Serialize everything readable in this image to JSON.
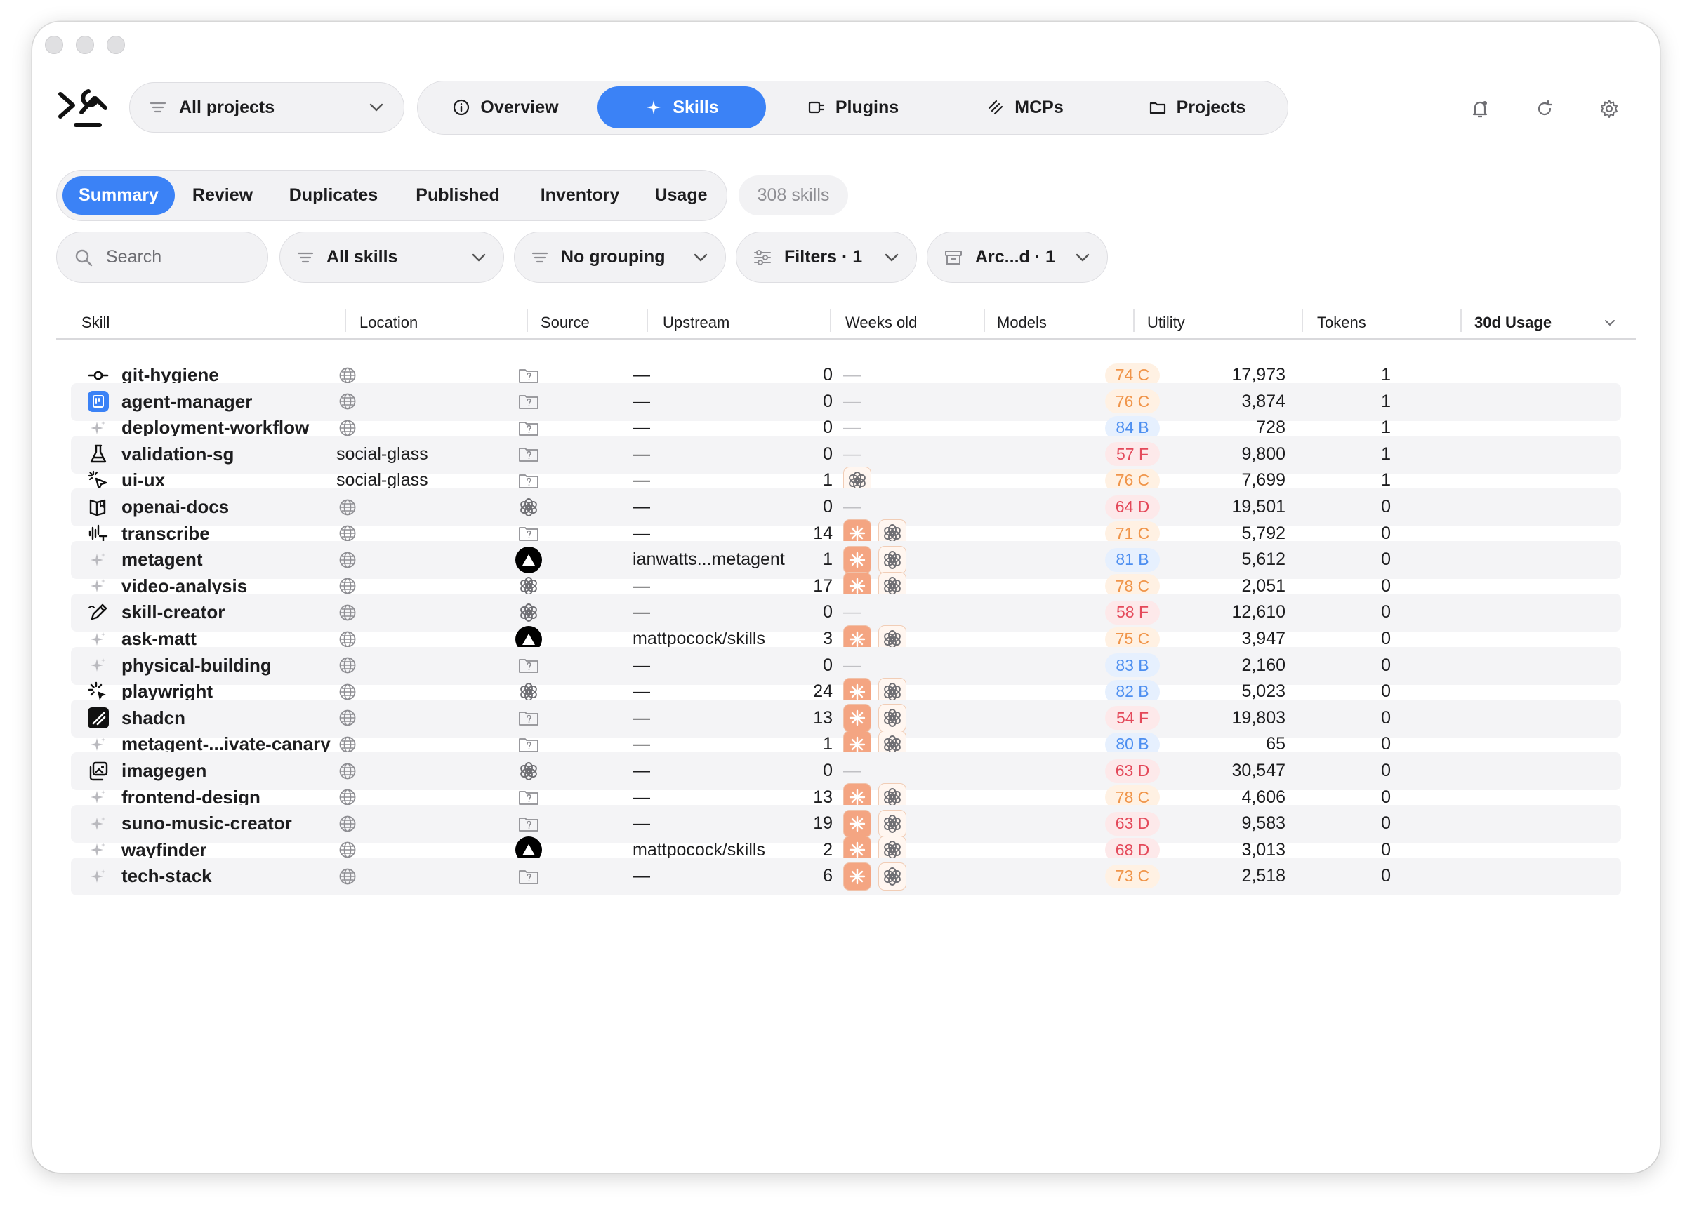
{
  "header": {
    "project_selector": "All projects",
    "nav_tabs": [
      {
        "label": "Overview",
        "icon": "info-circle-icon"
      },
      {
        "label": "Skills",
        "icon": "sparkle-icon",
        "active": true
      },
      {
        "label": "Plugins",
        "icon": "plug-icon"
      },
      {
        "label": "MCPs",
        "icon": "mcp-icon"
      },
      {
        "label": "Projects",
        "icon": "folder-icon"
      }
    ],
    "actions": [
      "bell-icon",
      "refresh-icon",
      "gear-icon"
    ]
  },
  "subnav": {
    "tabs": [
      "Summary",
      "Review",
      "Duplicates",
      "Published",
      "Inventory",
      "Usage"
    ],
    "active": "Summary",
    "count": "308 skills"
  },
  "filters": {
    "search_placeholder": "Search",
    "scope": "All skills",
    "grouping": "No grouping",
    "filters": "Filters · 1",
    "archive": "Arc...d · 1"
  },
  "table": {
    "columns": [
      "Skill",
      "Location",
      "Source",
      "Upstream",
      "Weeks old",
      "Models",
      "Utility",
      "Tokens",
      "30d Usage"
    ],
    "sorted_column": "30d Usage",
    "sort_direction": "descending",
    "colors": {
      "grade_C": "#f0954a",
      "grade_B": "#4c8ef0",
      "grade_D": "#e4495a",
      "grade_F": "#e4495a",
      "accent": "#3b82f6"
    },
    "rows": [
      {
        "skill": "git-hygiene",
        "icon": "commit-icon",
        "location": "",
        "source": "unknown",
        "upstream": "—",
        "weeks": "0",
        "models": [],
        "utility": "74 C",
        "grade": "C",
        "tokens": "17,973",
        "usage": "1"
      },
      {
        "skill": "agent-manager",
        "icon": "app-icon",
        "location": "",
        "source": "unknown",
        "upstream": "—",
        "weeks": "0",
        "models": [],
        "utility": "76 C",
        "grade": "C",
        "tokens": "3,874",
        "usage": "1"
      },
      {
        "skill": "deployment-workflow",
        "icon": "sparkle-icon",
        "location": "",
        "source": "unknown",
        "upstream": "—",
        "weeks": "0",
        "models": [],
        "utility": "84 B",
        "grade": "B",
        "tokens": "728",
        "usage": "1"
      },
      {
        "skill": "validation-sg",
        "icon": "flask-icon",
        "location": "social-glass",
        "source": "unknown",
        "upstream": "—",
        "weeks": "0",
        "models": [],
        "utility": "57 F",
        "grade": "F",
        "tokens": "9,800",
        "usage": "1"
      },
      {
        "skill": "ui-ux",
        "icon": "cursor-click-icon",
        "location": "social-glass",
        "source": "unknown",
        "upstream": "—",
        "weeks": "1",
        "models": [
          "openai"
        ],
        "utility": "76 C",
        "grade": "C",
        "tokens": "7,699",
        "usage": "1"
      },
      {
        "skill": "openai-docs",
        "icon": "book-icon",
        "location": "",
        "source": "openai",
        "upstream": "—",
        "weeks": "0",
        "models": [],
        "utility": "64 D",
        "grade": "D",
        "tokens": "19,501",
        "usage": "0"
      },
      {
        "skill": "transcribe",
        "icon": "waveform-icon",
        "location": "",
        "source": "unknown",
        "upstream": "—",
        "weeks": "14",
        "models": [
          "claude",
          "openai"
        ],
        "utility": "71 C",
        "grade": "C",
        "tokens": "5,792",
        "usage": "0"
      },
      {
        "skill": "metagent",
        "icon": "sparkle-icon",
        "location": "",
        "source": "vercel",
        "upstream": "ianwatts...metagent",
        "weeks": "1",
        "models": [
          "claude",
          "openai"
        ],
        "utility": "81 B",
        "grade": "B",
        "tokens": "5,612",
        "usage": "0"
      },
      {
        "skill": "video-analysis",
        "icon": "sparkle-icon",
        "location": "",
        "source": "openai",
        "upstream": "—",
        "weeks": "17",
        "models": [
          "claude",
          "openai"
        ],
        "utility": "78 C",
        "grade": "C",
        "tokens": "2,051",
        "usage": "0"
      },
      {
        "skill": "skill-creator",
        "icon": "pen-icon",
        "location": "",
        "source": "openai",
        "upstream": "—",
        "weeks": "0",
        "models": [],
        "utility": "58 F",
        "grade": "F",
        "tokens": "12,610",
        "usage": "0"
      },
      {
        "skill": "ask-matt",
        "icon": "sparkle-icon",
        "location": "",
        "source": "vercel",
        "upstream": "mattpocock/skills",
        "weeks": "3",
        "models": [
          "claude",
          "openai"
        ],
        "utility": "75 C",
        "grade": "C",
        "tokens": "3,947",
        "usage": "0"
      },
      {
        "skill": "physical-building",
        "icon": "sparkle-icon",
        "location": "",
        "source": "unknown",
        "upstream": "—",
        "weeks": "0",
        "models": [],
        "utility": "83 B",
        "grade": "B",
        "tokens": "2,160",
        "usage": "0"
      },
      {
        "skill": "playwright",
        "icon": "burst-cursor-icon",
        "location": "",
        "source": "openai",
        "upstream": "—",
        "weeks": "24",
        "models": [
          "claude",
          "openai"
        ],
        "utility": "82 B",
        "grade": "B",
        "tokens": "5,023",
        "usage": "0"
      },
      {
        "skill": "shadcn",
        "icon": "shadcn-icon",
        "location": "",
        "source": "unknown",
        "upstream": "—",
        "weeks": "13",
        "models": [
          "claude",
          "openai"
        ],
        "utility": "54 F",
        "grade": "F",
        "tokens": "19,803",
        "usage": "0"
      },
      {
        "skill": "metagent-...ivate-canary",
        "icon": "sparkle-icon",
        "location": "",
        "source": "unknown",
        "upstream": "—",
        "weeks": "1",
        "models": [
          "claude",
          "openai"
        ],
        "utility": "80 B",
        "grade": "B",
        "tokens": "65",
        "usage": "0"
      },
      {
        "skill": "imagegen",
        "icon": "image-icon",
        "location": "",
        "source": "openai",
        "upstream": "—",
        "weeks": "0",
        "models": [],
        "utility": "63 D",
        "grade": "D",
        "tokens": "30,547",
        "usage": "0"
      },
      {
        "skill": "frontend-design",
        "icon": "sparkle-icon",
        "location": "",
        "source": "unknown",
        "upstream": "—",
        "weeks": "13",
        "models": [
          "claude",
          "openai"
        ],
        "utility": "78 C",
        "grade": "C",
        "tokens": "4,606",
        "usage": "0"
      },
      {
        "skill": "suno-music-creator",
        "icon": "sparkle-icon",
        "location": "",
        "source": "unknown",
        "upstream": "—",
        "weeks": "19",
        "models": [
          "claude",
          "openai"
        ],
        "utility": "63 D",
        "grade": "D",
        "tokens": "9,583",
        "usage": "0"
      },
      {
        "skill": "wayfinder",
        "icon": "sparkle-icon",
        "location": "",
        "source": "vercel",
        "upstream": "mattpocock/skills",
        "weeks": "2",
        "models": [
          "claude",
          "openai"
        ],
        "utility": "68 D",
        "grade": "D",
        "tokens": "3,013",
        "usage": "0"
      },
      {
        "skill": "tech-stack",
        "icon": "sparkle-icon",
        "location": "",
        "source": "unknown",
        "upstream": "—",
        "weeks": "6",
        "models": [
          "claude",
          "openai"
        ],
        "utility": "73 C",
        "grade": "C",
        "tokens": "2,518",
        "usage": "0"
      }
    ]
  }
}
